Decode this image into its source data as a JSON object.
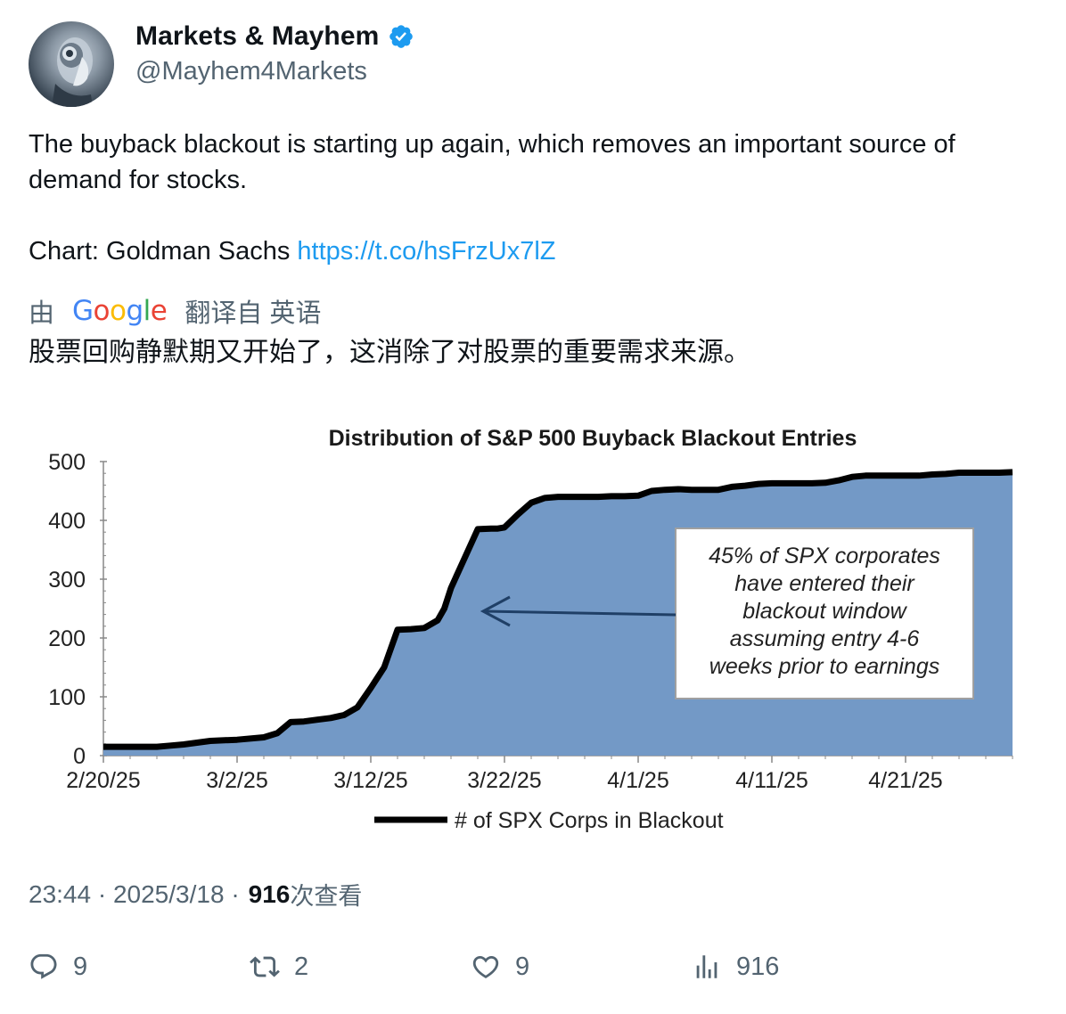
{
  "user": {
    "display_name": "Markets & Mayhem",
    "handle": "@Mayhem4Markets",
    "verified": true,
    "avatar_icon": "robot-avatar"
  },
  "tweet": {
    "text_line1": "The buyback blackout is starting up again, which removes an important source of demand for stocks.",
    "chart_prefix": "Chart: Goldman Sachs ",
    "link": "https://t.co/hsFrzUx7lZ"
  },
  "translation": {
    "by": "由",
    "provider": "Google",
    "from": "翻译自 英语",
    "text": "股票回购静默期又开始了，这消除了对股票的重要需求来源。"
  },
  "chart_data": {
    "type": "area",
    "title": "Distribution of S&P 500 Buyback Blackout Entries",
    "x_ticks": [
      "2/20/25",
      "3/2/25",
      "3/12/25",
      "3/22/25",
      "4/1/25",
      "4/11/25",
      "4/21/25"
    ],
    "y_ticks": [
      "0",
      "100",
      "200",
      "300",
      "400",
      "500"
    ],
    "ylim": [
      0,
      500
    ],
    "legend": "# of SPX Corps in Blackout",
    "annotation": [
      "45% of SPX corporates",
      "have entered their",
      "blackout window",
      "assuming entry 4-6",
      "weeks prior to earnings"
    ],
    "fill_color": "#7399c6",
    "line_color": "#000000",
    "series": [
      {
        "name": "# of SPX Corps in Blackout",
        "x_days": [
          0,
          4,
          5,
          6,
          8,
          10,
          12,
          13,
          14,
          15,
          16,
          17,
          18,
          19,
          20,
          21,
          22,
          23,
          24,
          25,
          25.5,
          26,
          27,
          28,
          29,
          29.5,
          30,
          31,
          32,
          33,
          34,
          35,
          36,
          37,
          38,
          39,
          40,
          41,
          42,
          43,
          44,
          45,
          46,
          47,
          48,
          49,
          50,
          51,
          52,
          53,
          54,
          55,
          56,
          57,
          58,
          59,
          60,
          61,
          62,
          63,
          64,
          65,
          66,
          67,
          68
        ],
        "y": [
          15,
          15,
          17,
          19,
          25,
          27,
          31,
          38,
          57,
          58,
          61,
          64,
          69,
          82,
          115,
          150,
          214,
          215,
          217,
          230,
          250,
          285,
          335,
          385,
          386,
          386,
          388,
          410,
          430,
          438,
          440,
          440,
          440,
          440,
          441,
          441,
          442,
          450,
          452,
          453,
          452,
          452,
          452,
          457,
          459,
          462,
          463,
          463,
          463,
          463,
          464,
          468,
          474,
          476,
          476,
          476,
          476,
          476,
          478,
          479,
          481,
          481,
          481,
          481,
          482
        ]
      }
    ]
  },
  "footer": {
    "time": "23:44",
    "date": "2025/3/18",
    "views": "916",
    "views_label": "次查看"
  },
  "actions": {
    "replies": "9",
    "reposts": "2",
    "likes": "9",
    "views": "916"
  }
}
